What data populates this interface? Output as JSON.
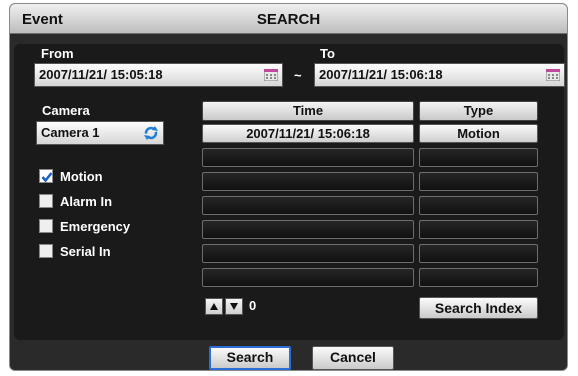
{
  "window": {
    "title_left": "Event",
    "title_center": "SEARCH"
  },
  "range": {
    "from_label": "From",
    "to_label": "To",
    "from_value": "2007/11/21/ 15:05:18",
    "to_value": "2007/11/21/ 15:06:18",
    "separator": "~"
  },
  "camera": {
    "label": "Camera",
    "value": "Camera 1"
  },
  "filters": [
    {
      "label": "Motion",
      "checked": true
    },
    {
      "label": "Alarm In",
      "checked": false
    },
    {
      "label": "Emergency",
      "checked": false
    },
    {
      "label": "Serial In",
      "checked": false
    }
  ],
  "table": {
    "headers": {
      "time": "Time",
      "type": "Type"
    },
    "rows": [
      {
        "time": "2007/11/21/ 15:06:18",
        "type": "Motion"
      },
      {
        "time": "",
        "type": ""
      },
      {
        "time": "",
        "type": ""
      },
      {
        "time": "",
        "type": ""
      },
      {
        "time": "",
        "type": ""
      },
      {
        "time": "",
        "type": ""
      },
      {
        "time": "",
        "type": ""
      }
    ]
  },
  "pager": {
    "page": "0"
  },
  "buttons": {
    "search_index": "Search Index",
    "search": "Search",
    "cancel": "Cancel"
  },
  "colors": {
    "focus": "#2b6fd6",
    "checkmark": "#1f5fc8"
  }
}
